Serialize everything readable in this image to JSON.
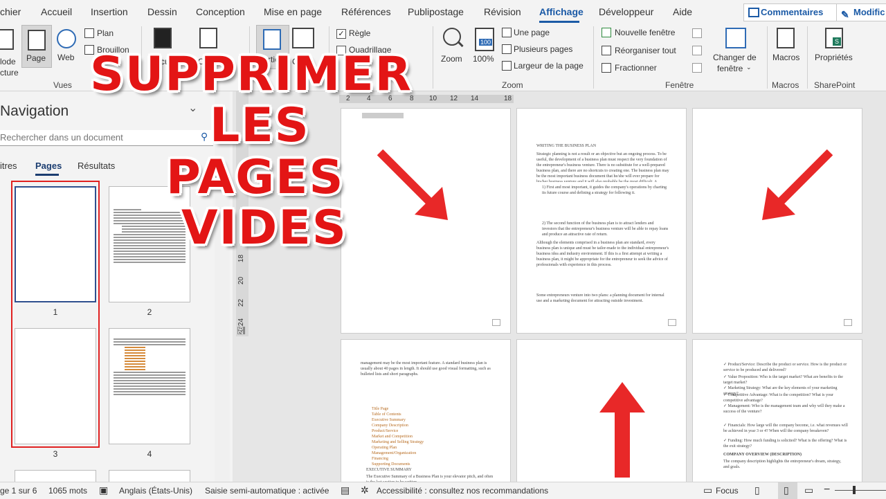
{
  "tabs": [
    "chier",
    "Accueil",
    "Insertion",
    "Dessin",
    "Conception",
    "Mise en page",
    "Références",
    "Publipostage",
    "Révision",
    "Affichage",
    "Développeur",
    "Aide"
  ],
  "active_tab": "Affichage",
  "top_buttons": {
    "comments": "Commentaires",
    "edit": "Modific"
  },
  "ribbon": {
    "vues": {
      "mode_lecture_1": "lode",
      "mode_lecture_2": "cture",
      "page": "Page",
      "web": "Web",
      "plan": "Plan",
      "brouillon": "Brouillon",
      "group": "Vues",
      "focus": "Focus",
      "outils": "Outils",
      "vertical": "Vertical",
      "cote": "Côte"
    },
    "afficher": {
      "regle": "Règle",
      "quadrillage": "Quadrillage",
      "regle_checked": "✓"
    },
    "zoom": {
      "zoom": "Zoom",
      "percent_top": "100",
      "percent": "100%",
      "une_page": "Une page",
      "plusieurs_pages": "Plusieurs pages",
      "largeur": "Largeur de la page",
      "group": "Zoom"
    },
    "fenetre": {
      "nouvelle": "Nouvelle fenêtre",
      "reorganiser": "Réorganiser tout",
      "fractionner": "Fractionner",
      "changer_1": "Changer de",
      "changer_2": "fenêtre",
      "group": "Fenêtre"
    },
    "macros": {
      "label": "Macros",
      "group": "Macros"
    },
    "sharepoint": {
      "label": "Propriétés",
      "group": "SharePoint"
    }
  },
  "navigation": {
    "title": "Navigation",
    "search_placeholder": "Rechercher dans un document",
    "tabs": [
      "itres",
      "Pages",
      "Résultats"
    ],
    "active_tab": "Pages",
    "thumb_numbers": [
      "1",
      "2",
      "3",
      "4"
    ]
  },
  "overlay_title": [
    "SUPPRIMER",
    "LES",
    "PAGES",
    "VIDES"
  ],
  "hruler": [
    "2",
    "4",
    "6",
    "8",
    "10",
    "12",
    "14",
    "18"
  ],
  "vruler": [
    "18",
    "20",
    "22",
    "24",
    "26"
  ],
  "page2": {
    "heading": "WRITING THE BUSINESS PLAN",
    "para1": "Strategic planning is not a result or an objective but an ongoing process. To be useful, the development of a business plan must respect the very foundation of the entrepreneur's business venture. There is no substitute for a well-prepared business plan, and there are no shortcuts to creating one. The business plan may be the most important business document that he/she will ever prepare for his/her business venture and it will also probably be the most difficult. A business plan has two essential functions:",
    "item1": "1) First and most important, it guides the company's operations by charting its future course and defining a strategy for following it.",
    "item2": "2) The second function of the business plan is to attract lenders and investors that the entrepreneur's business venture will be able to repay loans and produce an attractive rate of return.",
    "para2": "Although the elements comprised in a business plan are standard, every business plan is unique and must be tailor-made to the individual entrepreneur's business idea and industry environment. If this is a first attempt at writing a business plan, it might be appropriate for the entrepreneur to seek the advice of professionals with experience in this process.",
    "para3": "Some entrepreneurs venture into two plans: a planning document for internal use and a marketing document for attracting outside investment."
  },
  "page4": {
    "intro": "management may be the most important feature. A standard business plan is usually about 40 pages in length. It should use good visual formatting, such as bulleted lists and short paragraphs.",
    "checklist": [
      "Title Page",
      "Table of Contents",
      "Executive Summary",
      "Company Description",
      "Product/Service",
      "Market and Competition",
      "Marketing and Selling Strategy",
      "Operating Plan",
      "Management/Organization",
      "Financing",
      "Supporting Documents"
    ],
    "exec_title": "EXECUTIVE SUMMARY",
    "exec_text": "The Executive Summary of a Business Plan is your elevator pitch, and often is the last section to be written."
  },
  "page6": {
    "lines": [
      "✓ Product/Service: Describe the product or service. How is the product or service to be produced and delivered?",
      "✓ Value Proposition: Who is the target market? What are benefits to the target market?",
      "✓ Marketing Strategy: What are the key elements of your marketing strategy?",
      "✓ Competitive Advantage: What is the competition? What is your competitive advantage?",
      "✓ Management: Who is the management team and why will they make a success of the venture?"
    ],
    "financials": "✓ Financials: How large will the company become, i.e. what revenues will be achieved in year 3 or 4? When will the company breakeven?",
    "funding": "✓ Funding: How much funding is solicited? What is the offering? What is the exit strategy?",
    "company": "COMPANY OVERVIEW (DESCRIPTION)",
    "company_text": "The company description highlights the entrepreneur's dream, strategy, and goals."
  },
  "status": {
    "page": "ge 1 sur 6",
    "words": "1065 mots",
    "language": "Anglais (États-Unis)",
    "mode": "Saisie semi-automatique : activée",
    "accessibility": "Accessibilité : consultez nos recommandations",
    "focus": "Focus"
  },
  "colors": {
    "accent": "#1b5aa6",
    "title_red": "#e31515",
    "arrow_red": "#e82828",
    "thumb_highlight": "#e02020"
  }
}
